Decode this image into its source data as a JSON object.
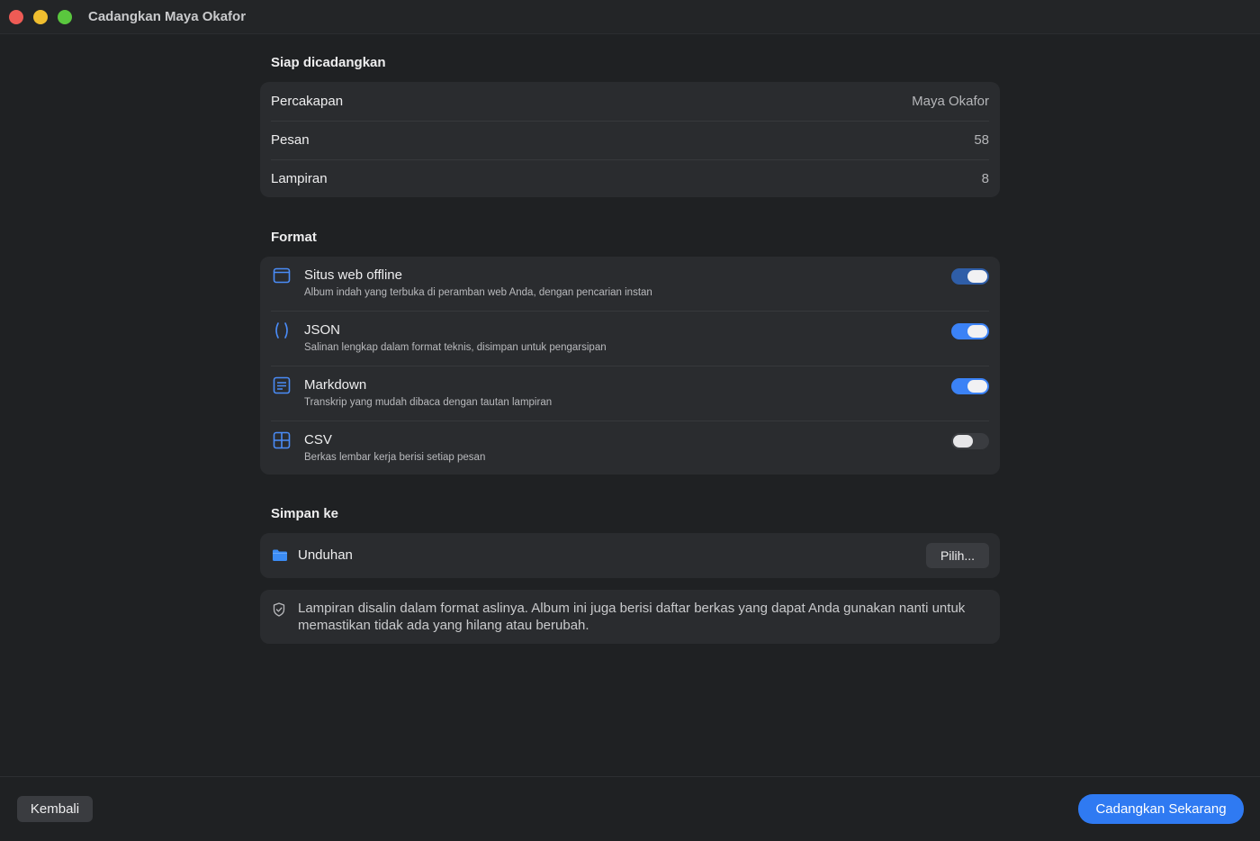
{
  "window": {
    "title": "Cadangkan Maya Okafor"
  },
  "summary": {
    "heading": "Siap dicadangkan",
    "rows": [
      {
        "label": "Percakapan",
        "value": "Maya Okafor"
      },
      {
        "label": "Pesan",
        "value": "58"
      },
      {
        "label": "Lampiran",
        "value": "8"
      }
    ]
  },
  "format": {
    "heading": "Format",
    "items": [
      {
        "icon": "browser-window-icon",
        "title": "Situs web offline",
        "description": "Album indah yang terbuka di peramban web Anda, dengan pencarian instan",
        "enabled": true
      },
      {
        "icon": "braces-icon",
        "title": "JSON",
        "description": "Salinan lengkap dalam format teknis, disimpan untuk pengarsipan",
        "enabled": true
      },
      {
        "icon": "document-text-icon",
        "title": "Markdown",
        "description": "Transkrip yang mudah dibaca dengan tautan lampiran",
        "enabled": true
      },
      {
        "icon": "grid-table-icon",
        "title": "CSV",
        "description": "Berkas lembar kerja berisi setiap pesan",
        "enabled": false
      }
    ]
  },
  "save_to": {
    "heading": "Simpan ke",
    "folder_icon": "folder-icon",
    "location": "Unduhan",
    "choose_label": "Pilih..."
  },
  "note": {
    "icon": "shield-check-icon",
    "text": "Lampiran disalin dalam format aslinya. Album ini juga berisi daftar berkas yang dapat Anda gunakan nanti untuk memastikan tidak ada yang hilang atau berubah."
  },
  "footer": {
    "back_label": "Kembali",
    "primary_label": "Cadangkan Sekarang"
  },
  "colors": {
    "accent": "#2f7af2",
    "background": "#1f2123",
    "card": "#2a2c2f"
  }
}
